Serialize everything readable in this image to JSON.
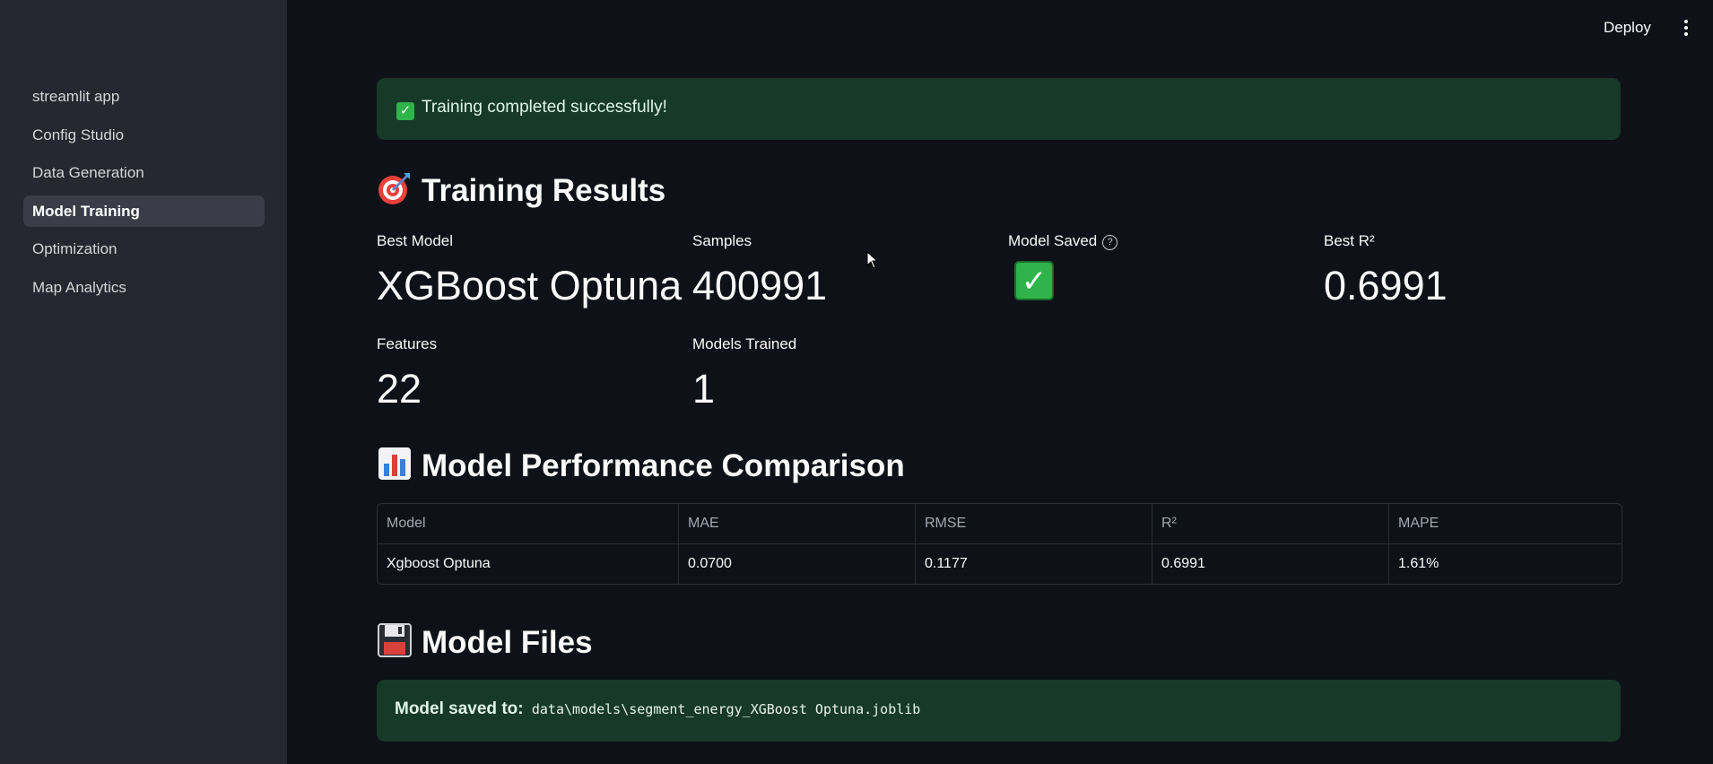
{
  "header": {
    "deploy_label": "Deploy",
    "menu_icon": "kebab-menu-icon"
  },
  "sidebar": {
    "items": [
      {
        "label": "streamlit app",
        "active": false
      },
      {
        "label": "Config Studio",
        "active": false
      },
      {
        "label": "Data Generation",
        "active": false
      },
      {
        "label": "Model Training",
        "active": true
      },
      {
        "label": "Optimization",
        "active": false
      },
      {
        "label": "Map Analytics",
        "active": false
      }
    ]
  },
  "success_alert": {
    "icon": "check-box-icon",
    "message": "Training completed successfully!"
  },
  "training_results": {
    "title": "Training Results",
    "icon": "target-icon",
    "metrics": {
      "best_model": {
        "label": "Best Model",
        "value": "XGBoost Optuna"
      },
      "samples": {
        "label": "Samples",
        "value": "400991"
      },
      "model_saved": {
        "label": "Model Saved",
        "value_icon": "check-box-icon",
        "help_icon": "help-circle-icon"
      },
      "best_r2": {
        "label": "Best R²",
        "value": "0.6991"
      },
      "features": {
        "label": "Features",
        "value": "22"
      },
      "models_trained": {
        "label": "Models Trained",
        "value": "1"
      }
    }
  },
  "comparison": {
    "title": "Model Performance Comparison",
    "icon": "bar-chart-icon",
    "columns": [
      "Model",
      "MAE",
      "RMSE",
      "R²",
      "MAPE"
    ],
    "rows": [
      [
        "Xgboost Optuna",
        "0.0700",
        "0.1177",
        "0.6991",
        "1.61%"
      ]
    ]
  },
  "model_files": {
    "title": "Model Files",
    "icon": "floppy-disk-icon",
    "saved_label": "Model saved to:",
    "saved_path": "data\\models\\segment_energy_XGBoost Optuna.joblib"
  },
  "colors": {
    "success_bg": "#173928",
    "sidebar_bg": "#262730",
    "app_bg": "#0e1117",
    "check_green": "#2fb34a"
  }
}
